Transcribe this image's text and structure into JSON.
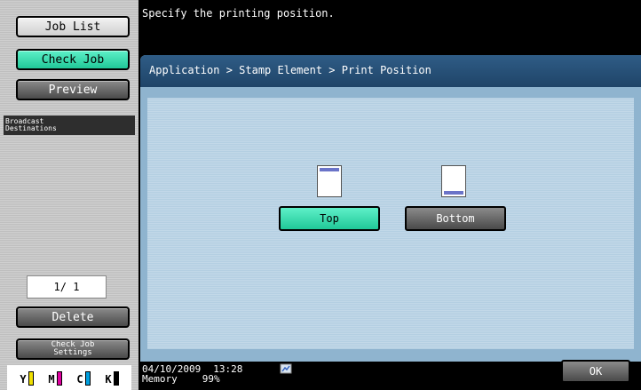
{
  "left_panel": {
    "job_list": "Job List",
    "check_job": "Check Job",
    "preview": "Preview",
    "broadcast_destinations": "Broadcast\nDestinations",
    "pager": "1/  1",
    "delete": "Delete",
    "check_job_settings": "Check Job\nSettings",
    "toner": [
      {
        "label": "Y",
        "color": "#f0e000"
      },
      {
        "label": "M",
        "color": "#e000a0"
      },
      {
        "label": "C",
        "color": "#00a0e0"
      },
      {
        "label": "K",
        "color": "#000000"
      }
    ]
  },
  "message": "Specify the printing position.",
  "breadcrumb": "Application > Stamp Element > Print Position",
  "options": {
    "top": "Top",
    "bottom": "Bottom"
  },
  "status": {
    "date": "04/10/2009",
    "time": "13:28",
    "memory_label": "Memory",
    "memory_value": "99%"
  },
  "ok": "OK"
}
